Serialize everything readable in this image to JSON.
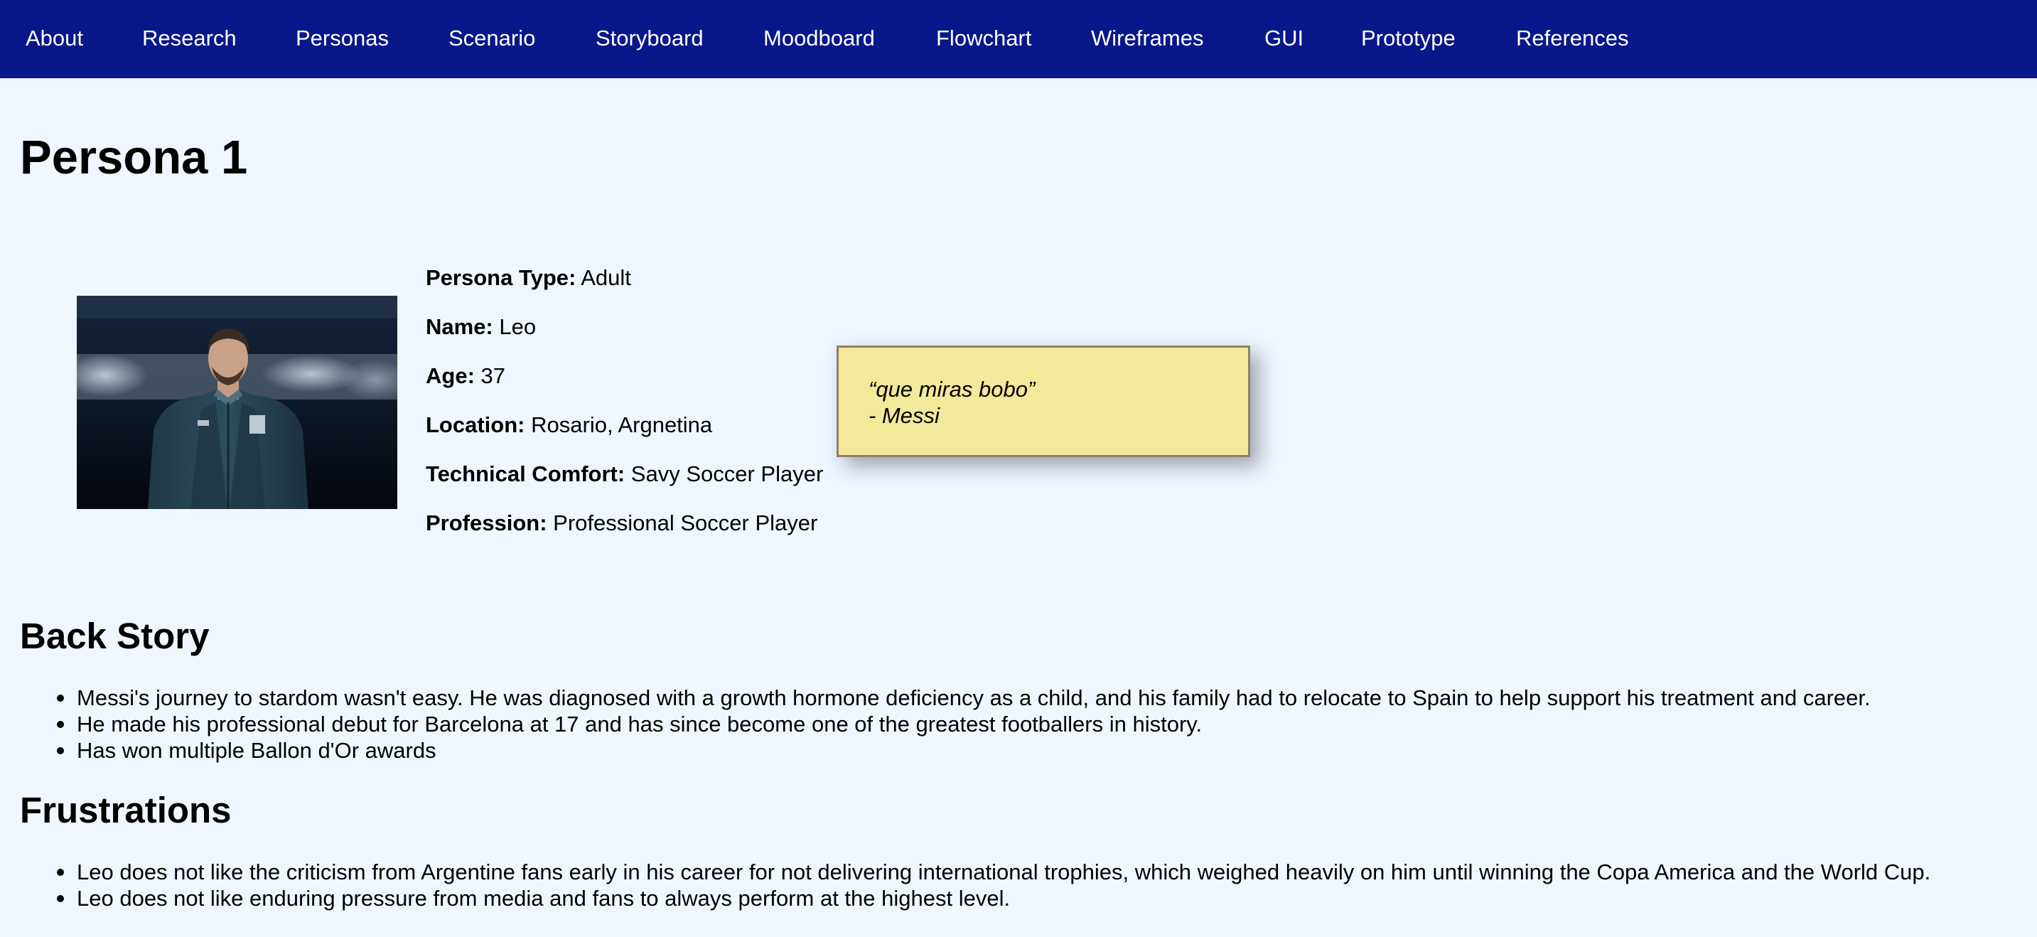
{
  "nav": {
    "items": [
      {
        "label": "About"
      },
      {
        "label": "Research"
      },
      {
        "label": "Personas"
      },
      {
        "label": "Scenario"
      },
      {
        "label": "Storyboard"
      },
      {
        "label": "Moodboard"
      },
      {
        "label": "Flowchart"
      },
      {
        "label": "Wireframes"
      },
      {
        "label": "GUI"
      },
      {
        "label": "Prototype"
      },
      {
        "label": "References"
      }
    ]
  },
  "persona": {
    "title": "Persona 1",
    "photo_alt": "Leo in a dark team jacket with eyes closed",
    "details": [
      {
        "label": "Persona Type:",
        "value": "Adult"
      },
      {
        "label": "Name:",
        "value": "Leo"
      },
      {
        "label": "Age:",
        "value": "37"
      },
      {
        "label": "Location:",
        "value": "Rosario, Argnetina"
      },
      {
        "label": "Technical Comfort:",
        "value": "Savy Soccer Player"
      },
      {
        "label": "Profession:",
        "value": "Professional Soccer Player"
      }
    ],
    "quote": {
      "text": "“que miras bobo”",
      "author": "- Messi"
    }
  },
  "back_story": {
    "heading": "Back Story",
    "items": [
      "Messi's journey to stardom wasn't easy. He was diagnosed with a growth hormone deficiency as a child, and his family had to relocate to Spain to help support his treatment and career.",
      "He made his professional debut for Barcelona at 17 and has since become one of the greatest footballers in history.",
      "Has won multiple Ballon d'Or awards"
    ]
  },
  "frustrations": {
    "heading": "Frustrations",
    "items": [
      "Leo does not like the criticism from Argentine fans early in his career for not delivering international trophies, which weighed heavily on him until winning the Copa America and the World Cup.",
      "Leo does not like enduring pressure from media and fans to always perform at the highest level."
    ]
  },
  "colors": {
    "nav_background": "#08178a",
    "page_background": "#eff6ff",
    "quote_background": "#f2e99a"
  }
}
